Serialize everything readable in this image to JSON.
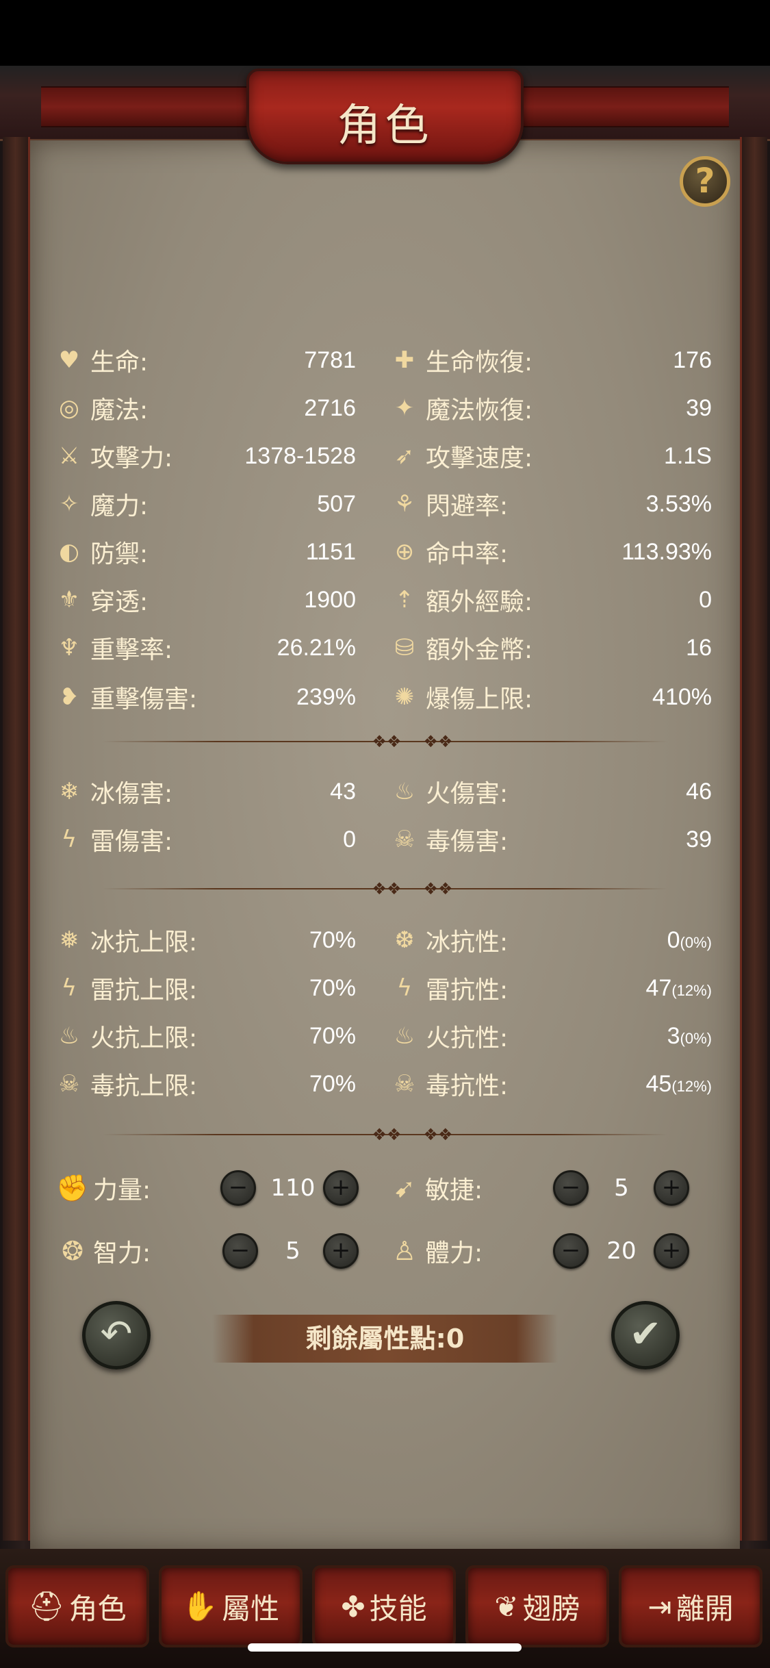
{
  "header": {
    "title": "角色"
  },
  "help": {
    "glyph": "?"
  },
  "stats_left": [
    {
      "icon": "heart-icon",
      "glyph": "♥",
      "label": "生命:",
      "value": "7781"
    },
    {
      "icon": "swirl-icon",
      "glyph": "◎",
      "label": "魔法:",
      "value": "2716"
    },
    {
      "icon": "sword-icon",
      "glyph": "⚔",
      "label": "攻擊力:",
      "value": "1378-1528"
    },
    {
      "icon": "magic-icon",
      "glyph": "✧",
      "label": "魔力:",
      "value": "507"
    },
    {
      "icon": "shield-icon",
      "glyph": "◐",
      "label": "防禦:",
      "value": "1151"
    },
    {
      "icon": "pierce-icon",
      "glyph": "⚜",
      "label": "穿透:",
      "value": "1900"
    },
    {
      "icon": "crit-icon",
      "glyph": "♆",
      "label": "重擊率:",
      "value": "26.21%"
    },
    {
      "icon": "broken-heart-icon",
      "glyph": "❥",
      "label": "重擊傷害:",
      "value": "239%"
    }
  ],
  "stats_right": [
    {
      "icon": "heart-plus-icon",
      "glyph": "✚",
      "label": "生命恢復:",
      "value": "176"
    },
    {
      "icon": "mana-regen-icon",
      "glyph": "✦",
      "label": "魔法恢復:",
      "value": "39"
    },
    {
      "icon": "attack-speed-icon",
      "glyph": "➶",
      "label": "攻擊速度:",
      "value": "1.1S"
    },
    {
      "icon": "dodge-icon",
      "glyph": "⚘",
      "label": "閃避率:",
      "value": "3.53%"
    },
    {
      "icon": "crosshair-icon",
      "glyph": "⊕",
      "label": "命中率:",
      "value": "113.93%"
    },
    {
      "icon": "exp-icon",
      "glyph": "⇡",
      "label": "額外經驗:",
      "value": "0"
    },
    {
      "icon": "coins-icon",
      "glyph": "⛁",
      "label": "額外金幣:",
      "value": "16"
    },
    {
      "icon": "burst-icon",
      "glyph": "✺",
      "label": "爆傷上限:",
      "value": "410%"
    }
  ],
  "damage_left": [
    {
      "icon": "snowflake-icon",
      "glyph": "❄",
      "label": "冰傷害:",
      "value": "43"
    },
    {
      "icon": "lightning-icon",
      "glyph": "ϟ",
      "label": "雷傷害:",
      "value": "0"
    }
  ],
  "damage_right": [
    {
      "icon": "fire-icon",
      "glyph": "♨",
      "label": "火傷害:",
      "value": "46"
    },
    {
      "icon": "poison-icon",
      "glyph": "☠",
      "label": "毒傷害:",
      "value": "39"
    }
  ],
  "resist_left": [
    {
      "icon": "ice-cap-icon",
      "glyph": "❅",
      "label": "冰抗上限:",
      "value": "70%"
    },
    {
      "icon": "thunder-cap-icon",
      "glyph": "ϟ",
      "label": "雷抗上限:",
      "value": "70%"
    },
    {
      "icon": "fire-cap-icon",
      "glyph": "♨",
      "label": "火抗上限:",
      "value": "70%"
    },
    {
      "icon": "poison-cap-icon",
      "glyph": "☠",
      "label": "毒抗上限:",
      "value": "70%"
    }
  ],
  "resist_right": [
    {
      "icon": "ice-resist-icon",
      "glyph": "❆",
      "label": "冰抗性:",
      "value": "0",
      "sub": "(0%)"
    },
    {
      "icon": "thunder-resist-icon",
      "glyph": "ϟ",
      "label": "雷抗性:",
      "value": "47",
      "sub": "(12%)"
    },
    {
      "icon": "fire-resist-icon",
      "glyph": "♨",
      "label": "火抗性:",
      "value": "3",
      "sub": "(0%)"
    },
    {
      "icon": "poison-resist-icon",
      "glyph": "☠",
      "label": "毒抗性:",
      "value": "45",
      "sub": "(12%)"
    }
  ],
  "attributes": [
    {
      "id": "strength",
      "icon": "fist-icon",
      "glyph": "✊",
      "label": "力量:",
      "value": "110"
    },
    {
      "id": "agility",
      "icon": "running-icon",
      "glyph": "➹",
      "label": "敏捷:",
      "value": "5"
    },
    {
      "id": "intelligence",
      "icon": "brain-icon",
      "glyph": "❂",
      "label": "智力:",
      "value": "5"
    },
    {
      "id": "stamina",
      "icon": "body-icon",
      "glyph": "♙",
      "label": "體力:",
      "value": "20"
    }
  ],
  "controls": {
    "minus_glyph": "−",
    "plus_glyph": "+",
    "back_glyph": "↶",
    "confirm_glyph": "✔"
  },
  "remaining_points": "剩餘屬性點:0",
  "tabs": [
    {
      "icon": "helmet-icon",
      "glyph": "⛑",
      "label": "角色"
    },
    {
      "icon": "attributes-icon",
      "glyph": "✋",
      "label": "屬性"
    },
    {
      "icon": "skills-icon",
      "glyph": "✤",
      "label": "技能"
    },
    {
      "icon": "wings-icon",
      "glyph": "❦",
      "label": "翅膀"
    },
    {
      "icon": "exit-icon",
      "glyph": "⇥",
      "label": "離開"
    }
  ]
}
